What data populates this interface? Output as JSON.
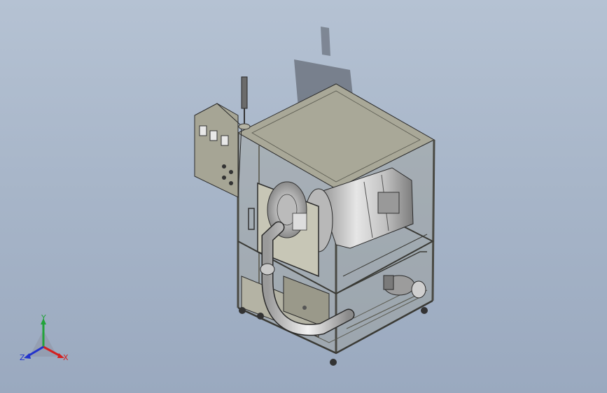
{
  "triad": {
    "x_label": "X",
    "y_label": "Y",
    "z_label": "Z",
    "x_color": "#d42020",
    "y_color": "#22a33a",
    "z_color": "#2233cc"
  },
  "colors": {
    "background_top": "#b5c2d3",
    "background_bottom": "#9aa9bf",
    "panel_fill": "#a6a595",
    "panel_dark": "#8d8c7d",
    "frame": "#6c6c64",
    "steel": "#d6d6d6",
    "outline": "#2a2a2a"
  },
  "icons": [
    "view-triad-icon",
    "signal-tower-icon",
    "control-box-icon"
  ]
}
